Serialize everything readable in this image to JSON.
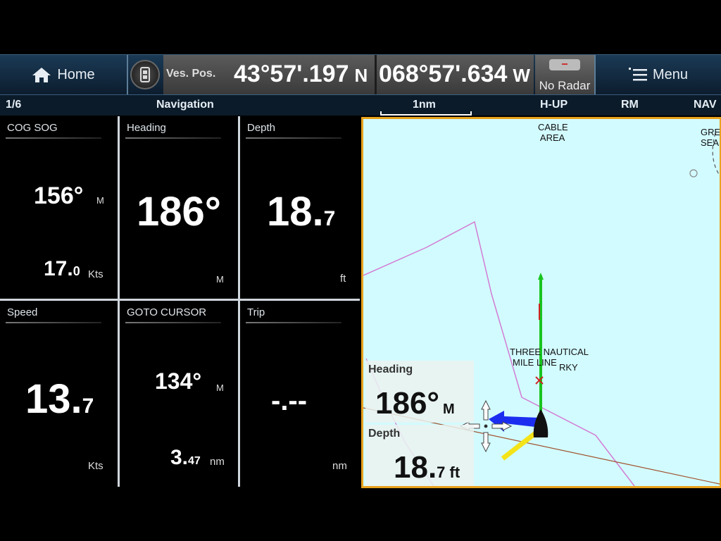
{
  "topbar": {
    "home_label": "Home",
    "pos_label": "Ves. Pos.",
    "lat_value": "43°57'.197",
    "lat_hem": "N",
    "lon_value": "068°57'.634",
    "lon_hem": "W",
    "radar_label": "No Radar",
    "menu_label": "Menu"
  },
  "status": {
    "page": "1/6",
    "page_title": "Navigation",
    "scale": "1nm",
    "orientation": "H-UP",
    "motion": "RM",
    "mode": "NAV"
  },
  "tiles": {
    "cog_sog": {
      "title": "COG SOG",
      "cog": "156°",
      "cog_unit": "M",
      "sog_int": "17.",
      "sog_dec": "0",
      "sog_unit": "Kts"
    },
    "heading": {
      "title": "Heading",
      "value": "186°",
      "unit": "M"
    },
    "depth": {
      "title": "Depth",
      "value_int": "18.",
      "value_dec": "7",
      "unit": "ft"
    },
    "speed": {
      "title": "Speed",
      "value_int": "13.",
      "value_dec": "7",
      "unit": "Kts"
    },
    "goto": {
      "title": "GOTO CURSOR",
      "bearing": "134°",
      "bearing_unit": "M",
      "dist_int": "3.",
      "dist_dec": "47",
      "dist_unit": "nm"
    },
    "trip": {
      "title": "Trip",
      "value": "-.--",
      "unit": "nm"
    }
  },
  "chart": {
    "label_cable": "CABLE\n AREA",
    "label_three": "THREE NAUTICAL",
    "label_mile": "MILE LINE",
    "label_rky": "RKY",
    "label_gre": "GRE",
    "label_sea": "SEA",
    "overlay_heading_title": "Heading",
    "overlay_heading_value": "186°",
    "overlay_heading_unit": "M",
    "overlay_depth_title": "Depth",
    "overlay_depth_int": "18.",
    "overlay_depth_dec": "7 ft"
  }
}
